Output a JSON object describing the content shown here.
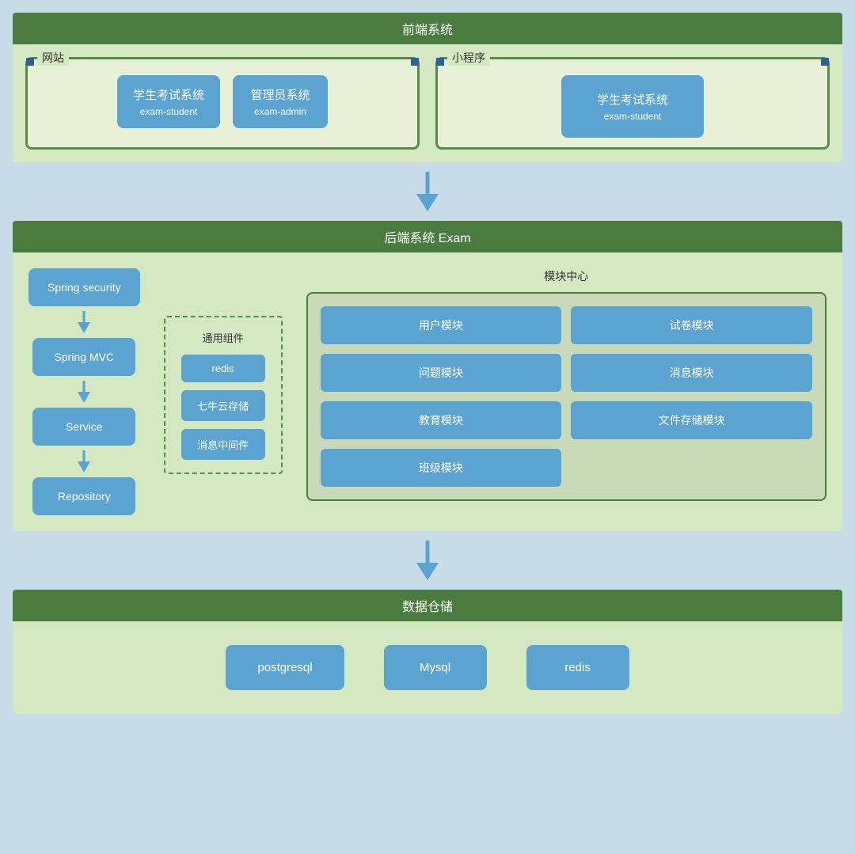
{
  "frontend": {
    "header": "前端系统",
    "website": {
      "label": "网站",
      "systems": [
        {
          "name": "学生考试系统",
          "sub": "exam-student"
        },
        {
          "name": "管理员系统",
          "sub": "exam-admin"
        }
      ]
    },
    "miniapp": {
      "label": "小程序",
      "systems": [
        {
          "name": "学生考试系统",
          "sub": "exam-student"
        }
      ]
    }
  },
  "backend": {
    "header": "后端系统 Exam",
    "chain": [
      {
        "id": "spring-security",
        "label": "Spring security"
      },
      {
        "id": "spring-mvc",
        "label": "Spring MVC"
      },
      {
        "id": "service",
        "label": "Service"
      },
      {
        "id": "repository",
        "label": "Repository"
      }
    ],
    "common": {
      "label": "通用组件",
      "items": [
        {
          "id": "redis",
          "label": "redis"
        },
        {
          "id": "qiniu",
          "label": "七牛云存储"
        },
        {
          "id": "mq",
          "label": "消息中间件"
        }
      ]
    },
    "modules": {
      "label": "模块中心",
      "items": [
        {
          "id": "user",
          "label": "用户模块"
        },
        {
          "id": "exam",
          "label": "试卷模块"
        },
        {
          "id": "question",
          "label": "问题模块"
        },
        {
          "id": "message",
          "label": "消息模块"
        },
        {
          "id": "education",
          "label": "教育模块"
        },
        {
          "id": "filestorage",
          "label": "文件存储模块"
        },
        {
          "id": "class",
          "label": "班级模块"
        }
      ]
    }
  },
  "datastorage": {
    "header": "数据仓储",
    "items": [
      {
        "id": "postgresql",
        "label": "postgresql"
      },
      {
        "id": "mysql",
        "label": "Mysql"
      },
      {
        "id": "redis",
        "label": "redis"
      }
    ]
  },
  "arrows": {
    "down": "▼"
  }
}
